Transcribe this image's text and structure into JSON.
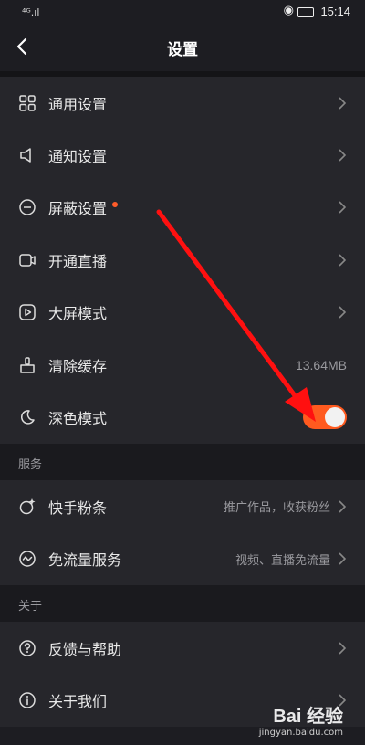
{
  "status": {
    "signal": "⁴ᴳ.ıl",
    "time": "15:14"
  },
  "header": {
    "title": "设置"
  },
  "section1": [
    {
      "label": "通用设置",
      "icon": "grid-icon"
    },
    {
      "label": "通知设置",
      "icon": "speaker-icon"
    },
    {
      "label": "屏蔽设置",
      "icon": "block-icon",
      "badge": true
    },
    {
      "label": "开通直播",
      "icon": "camera-icon"
    },
    {
      "label": "大屏模式",
      "icon": "play-icon"
    },
    {
      "label": "清除缓存",
      "icon": "broom-icon",
      "value": "13.64MB"
    },
    {
      "label": "深色模式",
      "icon": "moon-icon",
      "toggle": true
    }
  ],
  "services": {
    "header": "服务",
    "items": [
      {
        "label": "快手粉条",
        "icon": "sparkle-icon",
        "sub": "推广作品，收获粉丝"
      },
      {
        "label": "免流量服务",
        "icon": "wave-icon",
        "sub": "视频、直播免流量"
      }
    ]
  },
  "about": {
    "header": "关于",
    "items": [
      {
        "label": "反馈与帮助",
        "icon": "help-icon"
      },
      {
        "label": "关于我们",
        "icon": "info-icon"
      }
    ]
  },
  "dark_mode_on": true,
  "watermark": {
    "brand": "Bai 经验",
    "url": "jingyan.baidu.com"
  },
  "colors": {
    "accent": "#ff5a1f",
    "bg": "#1d1d22",
    "row_bg": "#26262b",
    "annotation": "#ff1010"
  }
}
